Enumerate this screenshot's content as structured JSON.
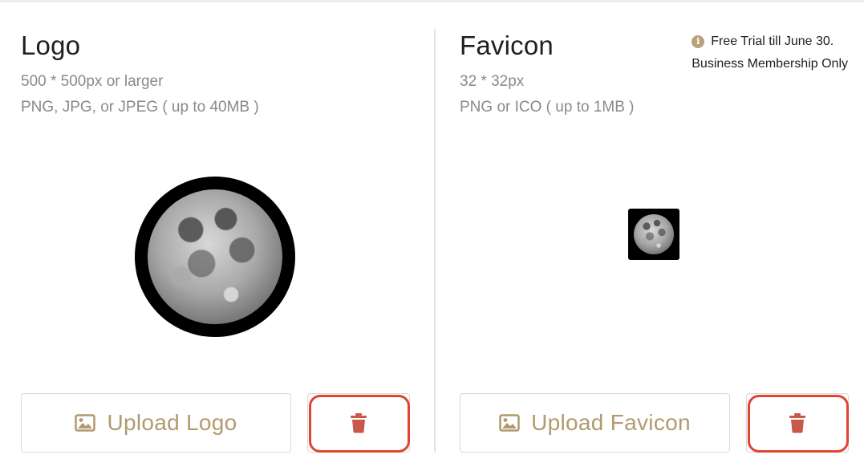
{
  "logo_panel": {
    "title": "Logo",
    "size_hint": "500 * 500px or larger",
    "format_hint": "PNG, JPG, or JPEG ( up to 40MB )",
    "upload_label": "Upload Logo"
  },
  "favicon_panel": {
    "title": "Favicon",
    "size_hint": "32 * 32px",
    "format_hint": "PNG or ICO ( up to 1MB )",
    "upload_label": "Upload Favicon",
    "trial_notice_line1": "Free Trial till June 30.",
    "trial_notice_line2": "Business Membership Only",
    "trial_icon_symbol": "i"
  },
  "colors": {
    "accent_gold": "#b19a6f",
    "delete_red": "#c9574a",
    "highlight_red": "#e0452f"
  },
  "icons": {
    "upload": "image-icon",
    "delete": "trash-icon",
    "notice": "info-icon"
  }
}
